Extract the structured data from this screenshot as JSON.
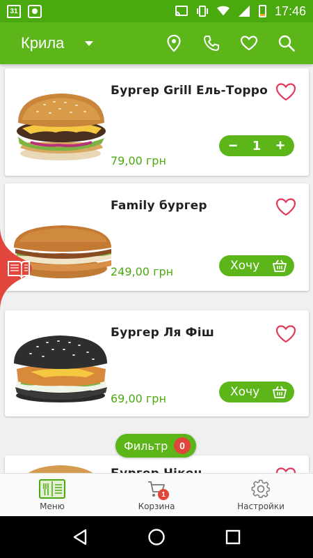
{
  "status_bar": {
    "calendar_day": "31",
    "time": "17:46",
    "battery_label": "8"
  },
  "app_bar": {
    "city": "Крила",
    "actions": [
      "location-icon",
      "phone-icon",
      "favorites-icon",
      "search-icon"
    ]
  },
  "products": [
    {
      "name": "Бургер Grill Ель-Торро",
      "price": "79,00 грн",
      "quantity": "1"
    },
    {
      "name": "Family бургер",
      "price": "249,00 грн",
      "button_label": "Хочу"
    },
    {
      "name": "Бургер Ля Фіш",
      "price": "69,00 грн",
      "button_label": "Хочу"
    },
    {
      "name": "Бургер Чікен"
    }
  ],
  "filter": {
    "label": "Фильтр",
    "count": "0"
  },
  "bottom_nav": {
    "menu_label": "Меню",
    "cart_label": "Корзина",
    "cart_count": "1",
    "settings_label": "Настройки"
  },
  "colors": {
    "brand_green": "#5cb61a",
    "status_green": "#4aa90f",
    "price_green": "#4aa90f",
    "heart_red": "#e0395a",
    "badge_red": "#e2453c"
  }
}
